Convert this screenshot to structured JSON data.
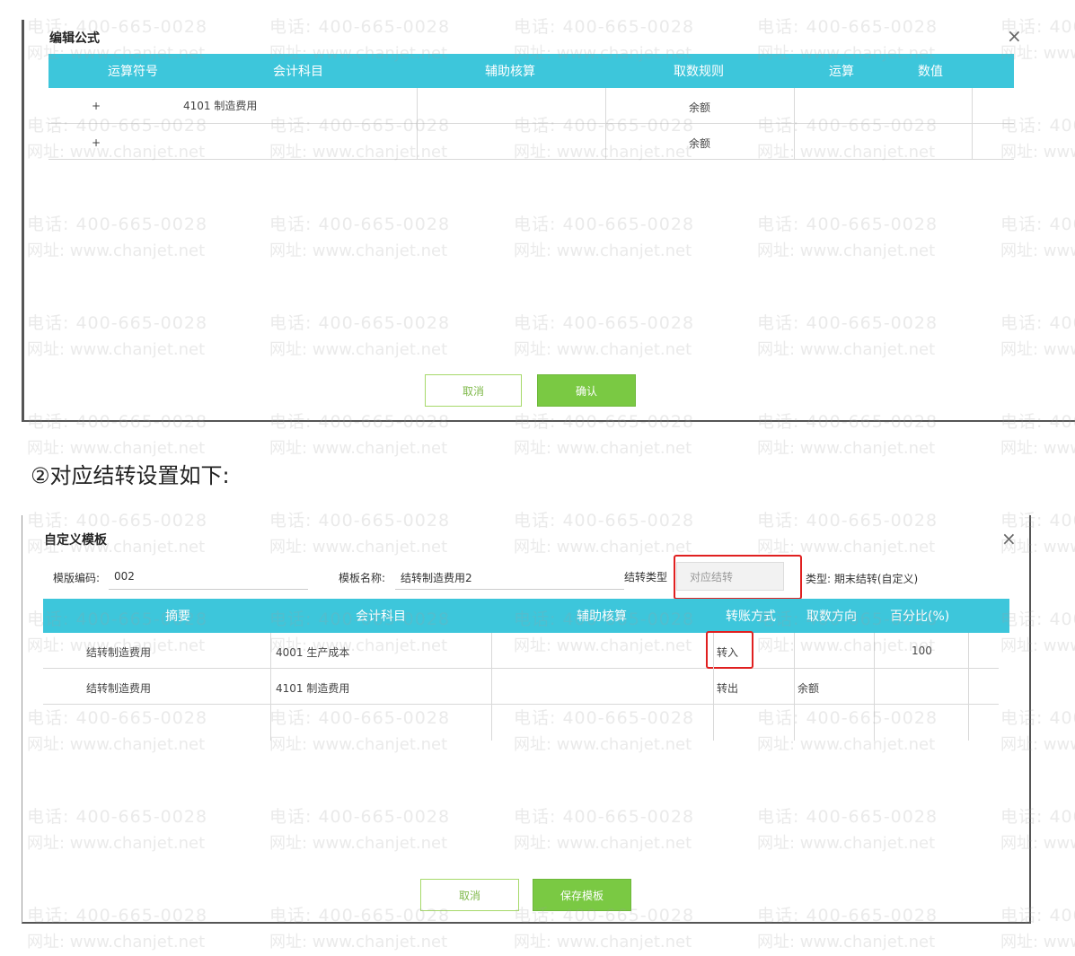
{
  "watermark": {
    "phone": "电话: 400-665-0028",
    "site": "网址: www.chanjet.net"
  },
  "dialog1": {
    "title": "编辑公式",
    "close_icon": "×",
    "headers": [
      "运算符号",
      "会计科目",
      "辅助核算",
      "取数规则",
      "运算",
      "数值"
    ],
    "rows": [
      {
        "operator": "+",
        "account": "4101 制造费用",
        "aux": "",
        "rule": "余额",
        "op": "",
        "value": ""
      },
      {
        "operator": "+",
        "account": "",
        "aux": "",
        "rule": "余额",
        "op": "",
        "value": ""
      }
    ],
    "cancel_label": "取消",
    "ok_label": "确认"
  },
  "caption": "②对应结转设置如下:",
  "dialog2": {
    "title": "自定义模板",
    "close_icon": "×",
    "template_code_label": "模版编码:",
    "template_code_value": "002",
    "template_name_label": "模板名称:",
    "template_name_value": "结转制造费用2",
    "transfer_type_label": "结转类型",
    "transfer_type_value": "对应结转",
    "category_text": "类型: 期末结转(自定义)",
    "headers": [
      "摘要",
      "会计科目",
      "辅助核算",
      "转账方式",
      "取数方向",
      "百分比(%)"
    ],
    "rows": [
      {
        "summary": "结转制造费用",
        "account": "4001 生产成本",
        "aux": "",
        "method": "转入",
        "direction": "",
        "percent": "100"
      },
      {
        "summary": "结转制造费用",
        "account": "4101 制造费用",
        "aux": "",
        "method": "转出",
        "direction": "余额",
        "percent": ""
      }
    ],
    "cancel_label": "取消",
    "save_label": "保存模板"
  },
  "colors": {
    "header_bg": "#3dc6db",
    "ok_green": "#7ac943",
    "highlight_red": "#e02020"
  }
}
